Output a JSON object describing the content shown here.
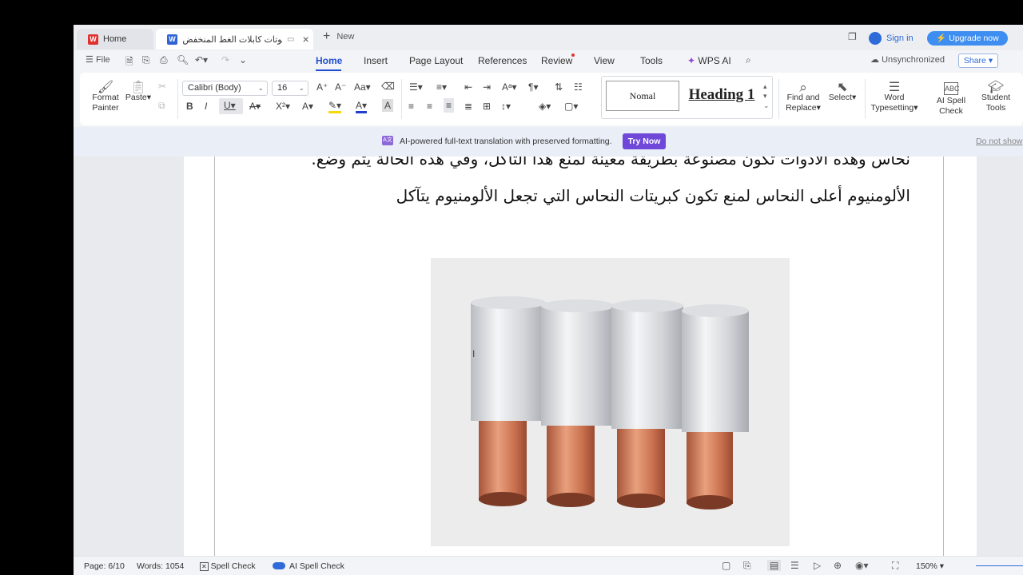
{
  "tabs": {
    "home": "Home",
    "doc": "ﻮﺗﺎﺕ ﻛﺎﺑﻼﺕ ﺍﻟﻐﻂ ﺍﻟﻤﻨﺨﻔﺾ 1",
    "close": "×",
    "new_plus": "+",
    "new_label": "New"
  },
  "account": {
    "sign_in": "Sign in",
    "upgrade": "⚡ Upgrade now"
  },
  "menu": {
    "file": "File",
    "items": [
      "Home",
      "Insert",
      "Page Layout",
      "References",
      "Review",
      "View",
      "Tools",
      "WPS AI"
    ],
    "sync": "Unsynchronized",
    "share": "Share"
  },
  "ribbon": {
    "format_painter": [
      "Format",
      "Painter"
    ],
    "paste": "Paste",
    "font_name": "Calibri (Body)",
    "font_size": "16",
    "style_normal": "Nomal",
    "style_heading": "Heading 1",
    "find_replace": [
      "Find and",
      "Replace"
    ],
    "select": "Select",
    "word_typesetting": [
      "Word",
      "Typesetting"
    ],
    "ai_spell_check": "AI Spell Check",
    "student_tools": [
      "Student",
      "Tools"
    ]
  },
  "translation_bar": {
    "icon": "A文",
    "text": "AI-powered full-text translation with preserved formatting.",
    "try_now": "Try Now",
    "do_not_show": "Do not show"
  },
  "document": {
    "line1": "نحاس وهذه الأدوات تكون مصنوعة بطريقة معينة لمنع هذا التآكل، وفي هذه الحالة يتم وضع.",
    "line2": "الألومنيوم أعلى النحاس لمنع تكون كبريتات النحاس التي تجعل الألومنيوم يتآكل"
  },
  "status": {
    "page": "Page: 6/10",
    "words": "Words: 1054",
    "spell_check": "Spell Check",
    "ai_spell_check": "AI Spell Check",
    "zoom": "150%"
  },
  "colors": {
    "accent": "#1f4fd1",
    "upgrade": "#3d8ef0",
    "try_now": "#6f47d9",
    "copper": "#c9704e",
    "aluminium": "#d8dadd"
  }
}
